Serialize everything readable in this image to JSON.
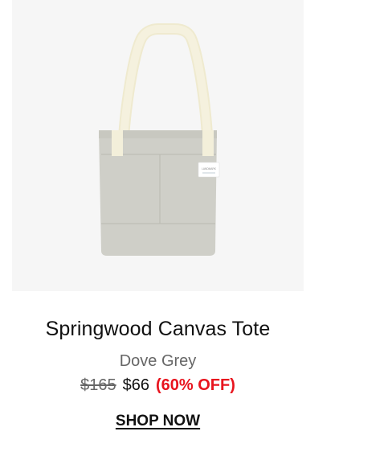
{
  "product": {
    "title": "Springwood Canvas Tote",
    "color_name": "Dove Grey",
    "price_original": "$165",
    "price_sale": "$66",
    "discount_label": "(60% OFF)",
    "cta_label": "SHOP NOW",
    "label_tag_text": "LANDMARK",
    "image_alt": "Springwood Canvas Tote"
  },
  "colors": {
    "discount": "#e8141e",
    "image_background": "#f6f6f6",
    "bag_body": "#cfcfc8",
    "strap": "#f2eed8"
  }
}
